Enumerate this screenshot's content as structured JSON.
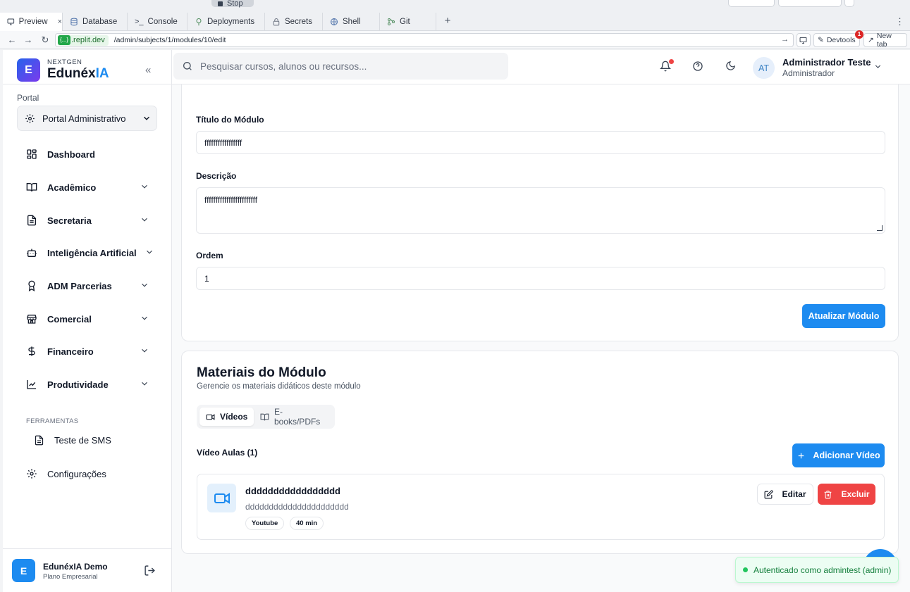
{
  "replit": {
    "top_button": "Stop",
    "tabs": [
      {
        "label": "Preview",
        "icon": "monitor-icon",
        "active": true
      },
      {
        "label": "Database",
        "icon": "database-icon"
      },
      {
        "label": "Console",
        "icon": "terminal-icon"
      },
      {
        "label": "Deployments",
        "icon": "deploy-icon"
      },
      {
        "label": "Secrets",
        "icon": "lock-icon"
      },
      {
        "label": "Shell",
        "icon": "shell-icon"
      },
      {
        "label": "Git",
        "icon": "git-icon"
      }
    ],
    "url_host": ".replit.dev",
    "url_host_badge": "{...}",
    "url_path": "/admin/subjects/1/modules/10/edit",
    "devtools_label": "Devtools",
    "devtools_badge": "1",
    "newtab_label": "New tab"
  },
  "sidebar": {
    "brand_small": "NEXTGEN",
    "brand_name_main": "Edunéx",
    "brand_name_accent": "IA",
    "logo_letter": "E",
    "portal_label": "Portal",
    "portal_value": "Portal Administrativo",
    "nav": [
      {
        "label": "Dashboard",
        "icon": "dashboard-icon",
        "has_chevron": false
      },
      {
        "label": "Acadêmico",
        "icon": "book-icon",
        "has_chevron": true
      },
      {
        "label": "Secretaria",
        "icon": "document-icon",
        "has_chevron": true
      },
      {
        "label": "Inteligência Artificial",
        "icon": "bot-icon",
        "has_chevron": true
      },
      {
        "label": "ADM Parcerias",
        "icon": "award-icon",
        "has_chevron": true
      },
      {
        "label": "Comercial",
        "icon": "store-icon",
        "has_chevron": true
      },
      {
        "label": "Financeiro",
        "icon": "dollar-icon",
        "has_chevron": true
      },
      {
        "label": "Produtividade",
        "icon": "chart-line-icon",
        "has_chevron": true
      }
    ],
    "tools_label": "FERRAMENTAS",
    "tools_item": "Teste de SMS",
    "settings_label": "Configurações",
    "footer_logo_letter": "E",
    "footer_name": "EdunéxIA Demo",
    "footer_plan": "Plano Empresarial"
  },
  "header": {
    "search_placeholder": "Pesquisar cursos, alunos ou recursos...",
    "avatar_initials": "AT",
    "user_name": "Administrador Teste",
    "user_role": "Administrador"
  },
  "module_form": {
    "title_label": "Título do Módulo",
    "title_value": "fffffffffffffffff",
    "description_label": "Descrição",
    "description_value": "ffffffffffffffffffffffff",
    "order_label": "Ordem",
    "order_value": "1",
    "submit_label": "Atualizar Módulo"
  },
  "materials": {
    "title": "Materiais do Módulo",
    "subtitle": "Gerencie os materiais didáticos deste módulo",
    "tabs": [
      {
        "label": "Vídeos",
        "active": true
      },
      {
        "label": "E-books/PDFs",
        "active": false
      }
    ],
    "list_title": "Vídeo Aulas (1)",
    "add_label": "Adicionar Vídeo",
    "videos": [
      {
        "title": "ddddddddddddddddd",
        "description": "dddddddddddddddddddddd",
        "source": "Youtube",
        "duration": "40 min",
        "edit_label": "Editar",
        "delete_label": "Excluir"
      }
    ]
  },
  "toast": {
    "message": "Autenticado como admintest (admin)"
  },
  "colors": {
    "primary": "#1d8bf0",
    "danger": "#ef4444",
    "success": "#22c55e"
  }
}
